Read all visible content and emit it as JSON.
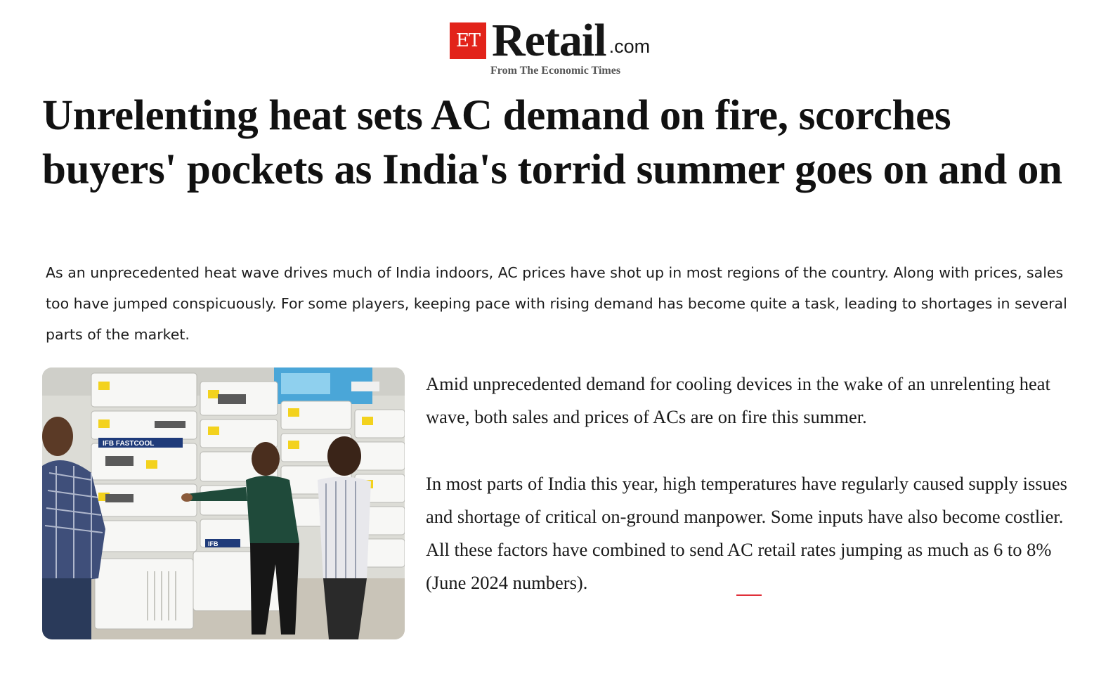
{
  "masthead": {
    "et_mark": "ET",
    "brand": "Retail",
    "domain_suffix": ".com",
    "tagline": "From The Economic Times",
    "colors": {
      "et_red": "#e2231a",
      "ink": "#161616"
    }
  },
  "article": {
    "headline": "Unrelenting heat sets AC demand on fire, scorches buyers' pockets as India's torrid summer goes on and on",
    "synopsis": "As an unprecedented heat wave drives much of India indoors, AC prices have shot up in most regions of the country. Along with prices, sales too have jumped conspicuously. For some players, keeping pace with rising demand has become quite a task, leading to shortages in several parts of the market.",
    "image": {
      "icon": "photo-icon",
      "signage": [
        "IFB FASTCOOL",
        "IFB"
      ]
    },
    "paragraphs": [
      "Amid unprecedented demand for cooling devices in the wake of an unrelenting heat wave, both sales and prices of ACs are on fire this summer.",
      "In most parts of India this year, high temperatures have regularly caused supply issues and shortage of critical on-ground manpower. Some inputs have also become costlier. All these factors have combined to send AC retail rates jumping as much as 6 to 8% (June 2024 numbers)."
    ]
  }
}
